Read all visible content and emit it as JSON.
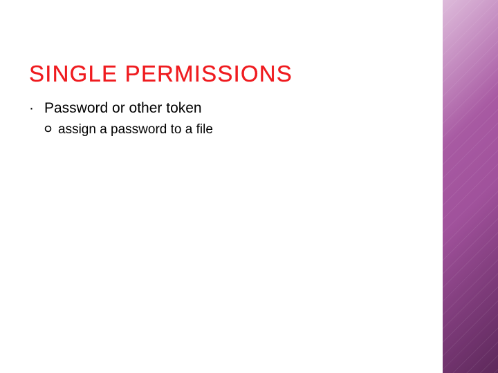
{
  "slide": {
    "title": "SINGLE PERMISSIONS",
    "bullets": [
      {
        "text": "Password or other token",
        "children": [
          {
            "text": "assign a password to a file"
          }
        ]
      }
    ]
  }
}
